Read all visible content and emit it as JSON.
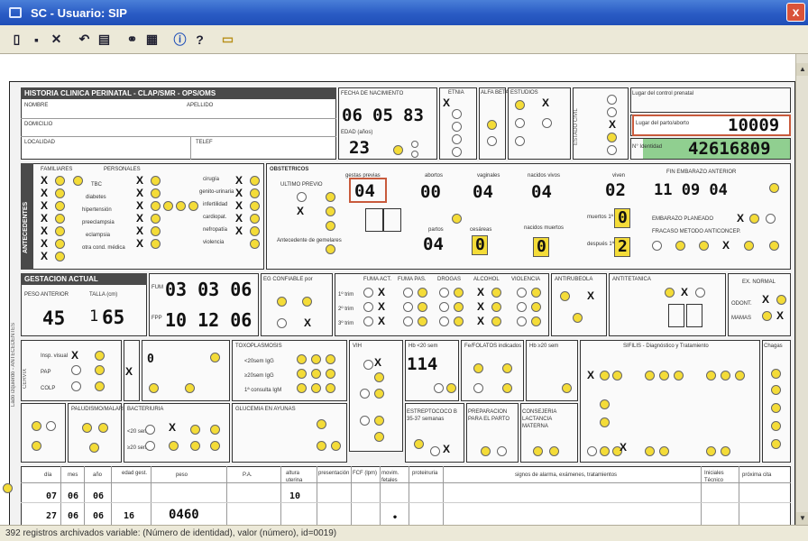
{
  "window": {
    "title": "SC - Usuario: SIP",
    "close": "x"
  },
  "toolbar": {
    "icons": [
      "new-icon",
      "save-icon",
      "delete-icon",
      "back-icon",
      "print-icon",
      "binoculars-icon",
      "grid-icon",
      "info-icon",
      "help-icon",
      "folder-icon"
    ]
  },
  "status": {
    "text": "392 registros archivados variable: (Número de identidad), valor (número), id=0019)"
  },
  "form": {
    "header_title": "HISTORIA CLINICA PERINATAL - CLAP/SMR - OPS/OMS",
    "labels": {
      "nombre": "NOMBRE",
      "apellido": "APELLIDO",
      "domicilio": "DOMICILIO",
      "localidad": "LOCALIDAD",
      "telef": "TELEF",
      "fecha_nacimiento": "FECHA DE NACIMIENTO",
      "edad": "EDAD (años)",
      "etnia": "ETNIA",
      "alfa_beta": "ALFA BETA",
      "estudios": "ESTUDIOS",
      "estado_civil": "ESTADO CIVIL",
      "lugar_control": "Lugar del control prenatal",
      "lugar_parto": "Lugar del parto/aborto",
      "no_identidad": "N° Identidad",
      "antecedentes": "ANTECEDENTES",
      "familiares": "FAMILIARES",
      "personales": "PERSONALES",
      "obstetricos": "OBSTETRICOS",
      "gestas_previas": "gestas previas",
      "abortos": "abortos",
      "vaginales": "vaginales",
      "nacidos_vivos": "nacidos vivos",
      "viven": "viven",
      "partos": "partos",
      "cesareas": "cesáreas",
      "nacidos_muertos": "nacidos muertos",
      "muertos_1sem": "muertos 1ª sem",
      "despues_1sem": "después 1ª sem",
      "fin_emb_anterior": "FIN EMBARAZO ANTERIOR",
      "emb_planeado": "EMBARAZO PLANEADO",
      "fracaso_metodo": "FRACASO METODO ANTICONCEP.",
      "gestacion_actual": "GESTACION ACTUAL",
      "peso_anterior": "PESO ANTERIOR",
      "talla": "TALLA (cm)",
      "fum": "FUM",
      "fpp": "FPP",
      "eg_confiable": "EG CONFIABLE por",
      "fuma_act": "FUMA ACT.",
      "fuma_pas": "FUMA PAS.",
      "drogas": "DROGAS",
      "alcohol": "ALCOHOL",
      "violencia": "VIOLENCIA",
      "antirubeola": "ANTIRUBEOLA",
      "antitetanica": "ANTITETANICA",
      "ex_normal": "EX. NORMAL",
      "odont": "ODONT.",
      "mamas": "MAMAS",
      "cervix": "CERVIX",
      "grupo": "GRUPO",
      "toxoplasmosis": "TOXOPLASMOSIS",
      "vih": "VIH",
      "hb": "Hb <20 sem",
      "hb2": "Hb ≥20 sem",
      "fe_folatos": "Fe/FOLATOS indicados",
      "sifilis": "SIFILIS - Diagnóstico y Tratamiento",
      "chagas": "Chagas",
      "paludismo": "PALUDISMO/MALARIA",
      "bacteriuria": "BACTERIURIA",
      "glucemia": "GLUCEMIA EN AYUNAS",
      "estreptococo": "ESTREPTOCOCO B 35-37 semanas",
      "preparacion": "PREPARACION PARA EL PARTO",
      "consejeria": "CONSEJERIA LACTANCIA MATERNA",
      "signos": "signos de alarma, exámenes, tratamientos",
      "iniciales": "Iniciales Técnico",
      "proxima_cita": "próxima cita"
    },
    "fecha_nacimiento": {
      "dia": "06",
      "mes": "05",
      "anio": "83"
    },
    "edad": "23",
    "lugar_control": "10009",
    "no_identidad": "42616809",
    "obstetricos": {
      "gestas_previas": "04",
      "abortos": "00",
      "vaginales": "04",
      "nacidos_vivos": "04",
      "viven": "02",
      "partos": "04",
      "cesareas": "0",
      "nacidos_muertos": "0",
      "muertos_1sem": "0",
      "despues_1sem": "2",
      "fin_emb_anterior": "11 09 04"
    },
    "peso_anterior": "45",
    "talla_prefix": "1",
    "talla": "65",
    "fum": "03 03 06",
    "fpp": "10 12 06",
    "hb": "114",
    "consultas": {
      "headers": [
        "día",
        "mes",
        "año",
        "edad gest.",
        "peso",
        "P.A.",
        "altura uterina",
        "presentación",
        "FCF (lpm)",
        "movim. fetales",
        "proteinuria"
      ],
      "rows": [
        {
          "dia": "07",
          "mes": "06",
          "anio": "06",
          "edad": "",
          "peso": "",
          "pa": "",
          "altura": "10"
        },
        {
          "dia": "27",
          "mes": "06",
          "anio": "06",
          "edad": "16",
          "peso": "0460",
          "pa": "",
          "altura": ""
        }
      ]
    }
  }
}
